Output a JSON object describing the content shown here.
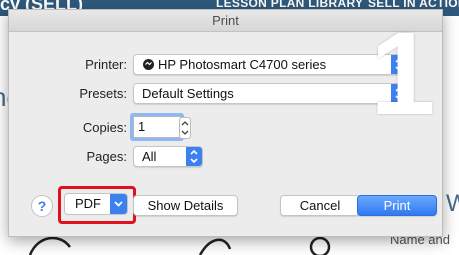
{
  "background_page": {
    "site_title": "cy (SELL)",
    "nav": [
      "LESSON PLAN LIBRARY",
      "SELL IN ACTION"
    ],
    "heading_left": "nc",
    "heading_right": "W",
    "footer_text": "Name and"
  },
  "dialog": {
    "title": "Print",
    "printer": {
      "label": "Printer:",
      "value": "HP Photosmart C4700 series"
    },
    "presets": {
      "label": "Presets:",
      "value": "Default Settings"
    },
    "copies": {
      "label": "Copies:",
      "value": "1"
    },
    "pages": {
      "label": "Pages:",
      "value": "All"
    },
    "footer": {
      "help_label": "?",
      "pdf_label": "PDF",
      "show_details_label": "Show Details",
      "cancel_label": "Cancel",
      "print_label": "Print"
    }
  },
  "overlay": {
    "step_number": "1"
  },
  "colors": {
    "accent_blue": "#3b82f0",
    "highlight_red": "#e0101c",
    "topbar": "#2f5a7d"
  }
}
